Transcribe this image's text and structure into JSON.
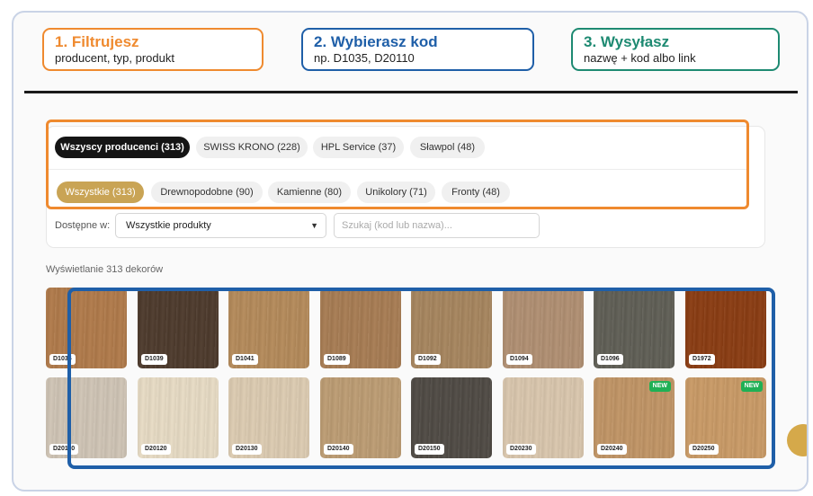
{
  "steps": [
    {
      "title": "1. Filtrujesz",
      "subtitle": "producent, typ, produkt",
      "color": "#ef8a2f"
    },
    {
      "title": "2. Wybierasz kod",
      "subtitle": "np. D1035, D20110",
      "color": "#1f5fa8"
    },
    {
      "title": "3. Wysyłasz",
      "subtitle": "nazwę + kod albo link",
      "color": "#1e8a72"
    }
  ],
  "producers": [
    {
      "label": "Wszyscy producenci (313)",
      "active": true
    },
    {
      "label": "SWISS KRONO (228)",
      "active": false
    },
    {
      "label": "HPL Service (37)",
      "active": false
    },
    {
      "label": "Sławpol (48)",
      "active": false
    }
  ],
  "types": [
    {
      "label": "Wszystkie (313)",
      "active": true
    },
    {
      "label": "Drewnopodobne (90)",
      "active": false
    },
    {
      "label": "Kamienne (80)",
      "active": false
    },
    {
      "label": "Unikolory (71)",
      "active": false
    },
    {
      "label": "Fronty (48)",
      "active": false
    }
  ],
  "availability": {
    "label": "Dostępne w:",
    "selected": "Wszystkie produkty",
    "search_placeholder": "Szukaj (kod lub nazwa)..."
  },
  "results": {
    "count_text": "Wyświetlanie 313 dekorów"
  },
  "decors": [
    {
      "code": "D1035",
      "color": "#b07a4a",
      "new": false
    },
    {
      "code": "D1039",
      "color": "#4d3a2c",
      "new": false
    },
    {
      "code": "D1041",
      "color": "#b48a5a",
      "new": false
    },
    {
      "code": "D1089",
      "color": "#a77c53",
      "new": false
    },
    {
      "code": "D1092",
      "color": "#a6855e",
      "new": false
    },
    {
      "code": "D1094",
      "color": "#b08f72",
      "new": false
    },
    {
      "code": "D1096",
      "color": "#5f5e55",
      "new": false
    },
    {
      "code": "D1972",
      "color": "#8a3c12",
      "new": false
    },
    {
      "code": "D20110",
      "color": "#cfc4b5",
      "new": false
    },
    {
      "code": "D20120",
      "color": "#e7dbc4",
      "new": false
    },
    {
      "code": "D20130",
      "color": "#dccbb1",
      "new": false
    },
    {
      "code": "D20140",
      "color": "#bc9c73",
      "new": false
    },
    {
      "code": "D20150",
      "color": "#4f4a44",
      "new": false
    },
    {
      "code": "D20230",
      "color": "#d9c6ad",
      "new": false
    },
    {
      "code": "D20240",
      "color": "#c09465",
      "new": true
    },
    {
      "code": "D20250",
      "color": "#c99a66",
      "new": true
    }
  ],
  "new_badge_label": "NEW"
}
